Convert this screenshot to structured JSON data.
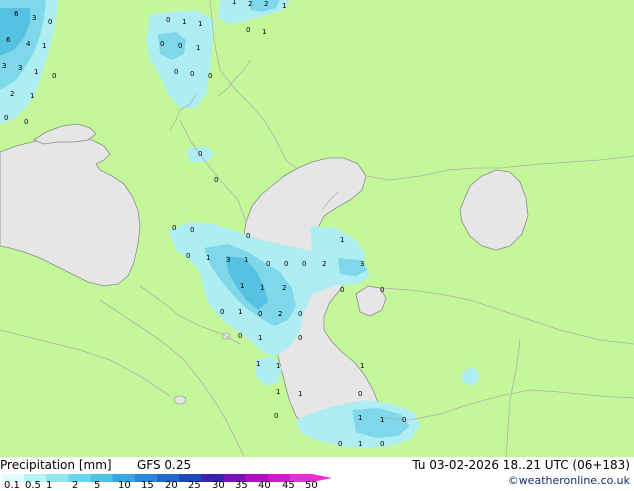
{
  "map": {
    "colors": {
      "sea": "#e6e6e6",
      "land": "#c4f79a",
      "precip_light": "#aeeef2",
      "precip_mid": "#7fd8ea",
      "precip_strong": "#56c2e2",
      "border": "#b0b0b0",
      "coast": "#8c8c8c"
    },
    "value_labels": [
      "0",
      "1",
      "2",
      "3",
      "4",
      "5",
      "6"
    ]
  },
  "footer": {
    "title": "Precipitation [mm]",
    "model": "GFS 0.25",
    "date": "Tu 03-02-2026 18..21 UTC (06+183)",
    "copyright": "©weatheronline.co.uk",
    "scale_ticks": [
      "0.1",
      "0.5",
      "1",
      "2",
      "5",
      "10",
      "15",
      "20",
      "25",
      "30",
      "35",
      "40",
      "45",
      "50"
    ],
    "scale_colors": [
      "#e0fbfb",
      "#b9f3f6",
      "#8fe6f1",
      "#6cd6ec",
      "#4fc2e6",
      "#3aa7e0",
      "#2c88d6",
      "#2468c8",
      "#1f48b6",
      "#3a22b0",
      "#7a12b8",
      "#b010c0",
      "#d616c8",
      "#ee2ed2"
    ]
  }
}
